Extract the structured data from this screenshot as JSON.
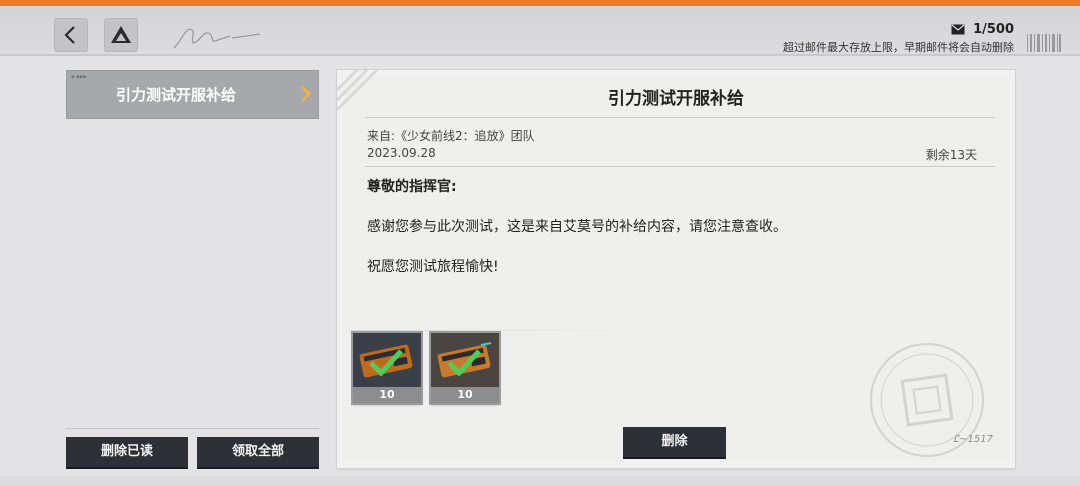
{
  "header": {
    "mail_count": "1/500",
    "mail_limit_note": "超过邮件最大存放上限，早期邮件将会自动删除"
  },
  "mail_list": {
    "items": [
      {
        "title": "引力测试开服补给"
      }
    ]
  },
  "left_actions": {
    "delete_read_label": "删除已读",
    "claim_all_label": "领取全部"
  },
  "mail": {
    "title": "引力测试开服补给",
    "sender": "来自:《少女前线2：追放》团队",
    "date": "2023.09.28",
    "remaining": "剩余13天",
    "greeting": "尊敬的指挥官:",
    "body_line1": "感谢您参与此次测试，这是来自艾莫号的补给内容，请您注意查收。",
    "body_line2": "祝愿您测试旅程愉快!",
    "attachments": [
      {
        "quantity": "10",
        "icon": "supply-card-icon",
        "claimed": true
      },
      {
        "quantity": "10",
        "icon": "supply-card-icon",
        "claimed": true
      }
    ],
    "delete_label": "删除"
  },
  "colors": {
    "accent_orange": "#ee7a25",
    "button_dark": "#2d3036",
    "check_green": "#4ccf5a",
    "selected_item_bg": "#a7a8ab"
  }
}
